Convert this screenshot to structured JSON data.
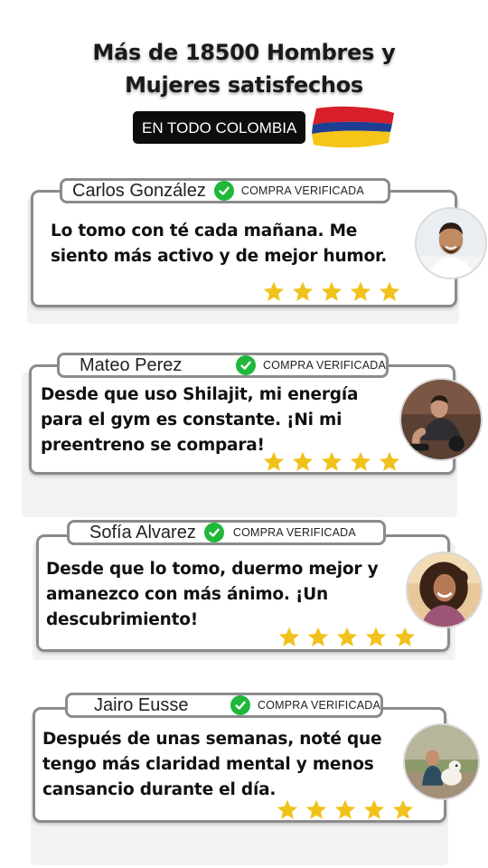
{
  "header": {
    "headline_line1": "Más de 18500 Hombres y",
    "headline_line2": "Mujeres satisfechos",
    "region_badge": "EN TODO COLOMBIA",
    "flag_icon": "colombia-flag-icon",
    "flag_colors": [
      "#d81f2a",
      "#1e3e94",
      "#f5c518"
    ]
  },
  "verified_label": "COMPRA VERIFICADA",
  "colors": {
    "star": "#f1c21b",
    "check": "#1fb83a",
    "border": "#8b8b8b"
  },
  "reviews": [
    {
      "name": "Carlos González",
      "text": "Lo tomo con té cada mañana. Me siento más activo y de mejor humor.",
      "rating": 5,
      "avatar_icon": "man-smiling-avatar"
    },
    {
      "name": "Mateo Perez",
      "text": "Desde que uso Shilajit, mi energía para el gym es constante. ¡Ni mi preentreno se compara!",
      "rating": 5,
      "avatar_icon": "man-gym-avatar"
    },
    {
      "name": "Sofía Alvarez",
      "text": "Desde que lo tomo, duermo mejor y amanezco con más ánimo. ¡Un descubrimiento!",
      "rating": 5,
      "avatar_icon": "woman-smiling-avatar"
    },
    {
      "name": "Jairo Eusse",
      "text": "Después de unas semanas, noté que tengo más claridad mental y menos cansancio durante el día.",
      "rating": 5,
      "avatar_icon": "man-with-dog-avatar"
    }
  ]
}
